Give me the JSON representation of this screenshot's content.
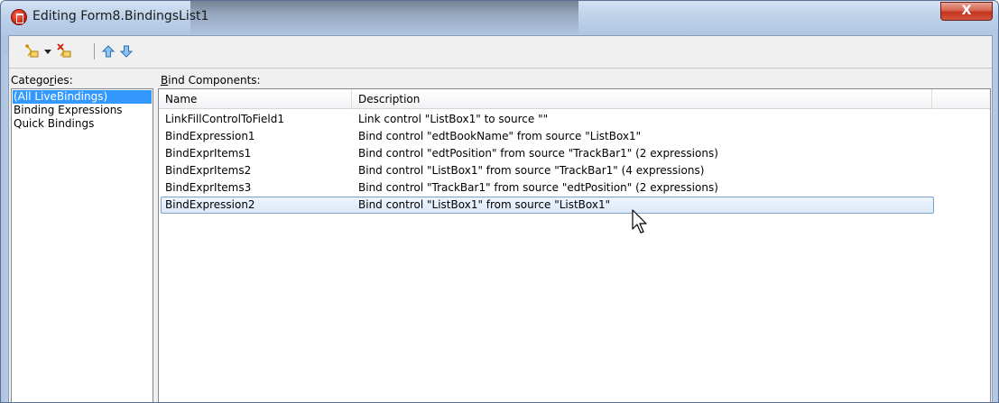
{
  "window": {
    "title": "Editing Form8.BindingsList1",
    "close_label": "X"
  },
  "toolbar": {
    "icons": [
      "new-binding-icon",
      "dropdown-arrow-icon",
      "delete-binding-icon",
      "move-up-icon",
      "move-down-icon"
    ]
  },
  "categories": {
    "label_prefix": "Catego",
    "label_accel": "r",
    "label_suffix": "ies:",
    "items": [
      "(All LiveBindings)",
      "Binding Expressions",
      "Quick Bindings"
    ],
    "selected_index": 0
  },
  "components": {
    "label_accel": "B",
    "label_suffix": "ind Components:",
    "columns": [
      "Name",
      "Description"
    ],
    "rows": [
      {
        "name": "LinkFillControlToField1",
        "description": "Link control \"ListBox1\" to source \"\""
      },
      {
        "name": "BindExpression1",
        "description": "Bind control \"edtBookName\" from source \"ListBox1\""
      },
      {
        "name": "BindExprItems1",
        "description": "Bind control \"edtPosition\" from source \"TrackBar1\" (2 expressions)"
      },
      {
        "name": "BindExprItems2",
        "description": "Bind control \"ListBox1\" from source \"TrackBar1\" (4 expressions)"
      },
      {
        "name": "BindExprItems3",
        "description": "Bind control \"TrackBar1\" from source \"edtPosition\" (2 expressions)"
      },
      {
        "name": "BindExpression2",
        "description": "Bind control \"ListBox1\" from source \"ListBox1\""
      }
    ],
    "selected_index": 5
  },
  "colors": {
    "selection": "#3399ff",
    "row_selection_border": "#7da2ce",
    "close_button": "#c2331d"
  }
}
